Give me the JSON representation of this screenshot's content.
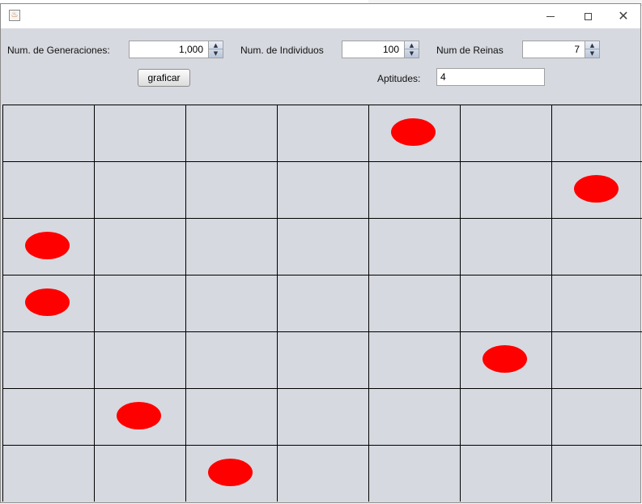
{
  "controls": {
    "generations_label": "Num. de Generaciones:",
    "generations_value": "1,000",
    "individuals_label": "Num. de Individuos",
    "individuals_value": "100",
    "queens_label": "Num de Reinas",
    "queens_value": "7",
    "graph_button": "graficar",
    "fitness_label": "Aptitudes:",
    "fitness_value": "4"
  },
  "board": {
    "size": 7,
    "queen_color": "#ff0000",
    "line_color": "#000000",
    "queens": [
      {
        "row": 0,
        "col": 4
      },
      {
        "row": 1,
        "col": 6
      },
      {
        "row": 2,
        "col": 0
      },
      {
        "row": 3,
        "col": 0
      },
      {
        "row": 4,
        "col": 5
      },
      {
        "row": 5,
        "col": 1
      },
      {
        "row": 6,
        "col": 2
      }
    ]
  }
}
